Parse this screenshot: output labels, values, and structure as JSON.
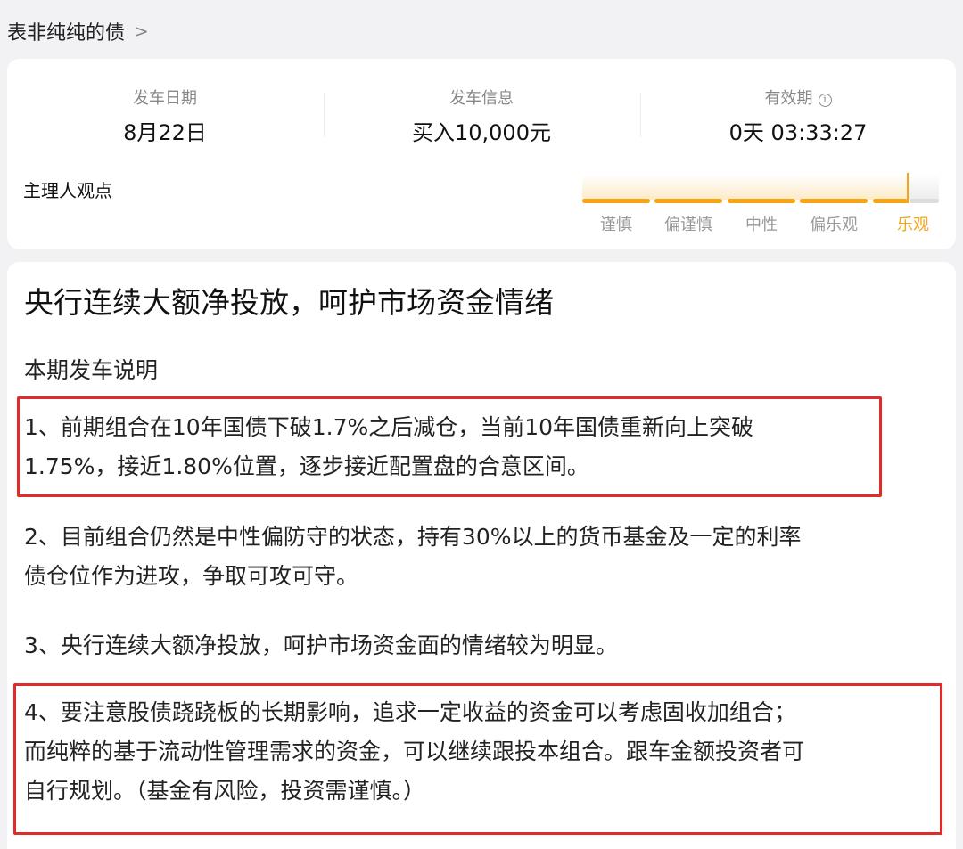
{
  "header": {
    "title": "表非纯纯的债",
    "chevron": ">"
  },
  "stats": [
    {
      "label": "发车日期",
      "value": "8月22日"
    },
    {
      "label": "发车信息",
      "value": "买入10,000元"
    },
    {
      "label": "有效期",
      "value": "0天 03:33:27",
      "info_icon": "i"
    }
  ],
  "view": {
    "label": "主理人观点",
    "levels": [
      "谨慎",
      "偏谨慎",
      "中性",
      "偏乐观",
      "乐观"
    ],
    "selected": "乐观",
    "colors": {
      "active": "#f5a516",
      "inactive": "#999999"
    }
  },
  "article": {
    "title": "央行连续大额净投放，呵护市场资金情绪",
    "subtitle": "本期发车说明",
    "paragraphs": [
      {
        "lines": [
          "1、前期组合在10年国债下破1.7%之后减仓，当前10年国债重新向上突破",
          "1.75%，接近1.80%位置，逐步接近配置盘的合意区间。"
        ],
        "highlighted": true
      },
      {
        "lines": [
          "2、目前组合仍然是中性偏防守的状态，持有30%以上的货币基金及一定的利率",
          "债仓位作为进攻，争取可攻可守。"
        ],
        "highlighted": false
      },
      {
        "lines": [
          "3、央行连续大额净投放，呵护市场资金面的情绪较为明显。"
        ],
        "highlighted": false
      },
      {
        "lines": [
          "4、要注意股债跷跷板的长期影响，追求一定收益的资金可以考虑固收加组合；",
          "而纯粹的基于流动性管理需求的资金，可以继续跟投本组合。跟车金额投资者可",
          "自行规划。（基金有风险，投资需谨慎。）"
        ],
        "highlighted": true
      }
    ],
    "highlight_color": "#e02b2b"
  }
}
